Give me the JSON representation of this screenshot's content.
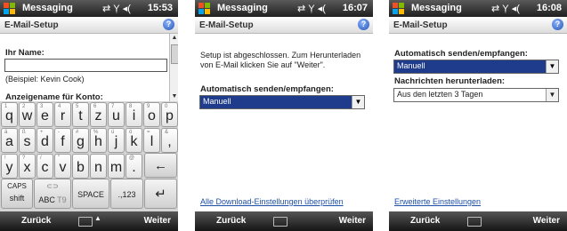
{
  "screens": [
    {
      "status": {
        "app": "Messaging",
        "time": "15:53"
      },
      "header": "E-Mail-Setup",
      "name_label": "Ihr Name:",
      "name_example": "(Beispiel: Kevin Cook)",
      "display_name_label": "Anzeigename für Konto:",
      "keyboard": {
        "row1": [
          {
            "m": "q",
            "s": "1"
          },
          {
            "m": "w",
            "s": "2"
          },
          {
            "m": "e",
            "s": "3"
          },
          {
            "m": "r",
            "s": "4"
          },
          {
            "m": "t",
            "s": "5"
          },
          {
            "m": "z",
            "s": "6"
          },
          {
            "m": "u",
            "s": "7"
          },
          {
            "m": "i",
            "s": "8"
          },
          {
            "m": "o",
            "s": "9"
          },
          {
            "m": "p",
            "s": "0"
          }
        ],
        "row2": [
          {
            "m": "a",
            "s": "ä"
          },
          {
            "m": "s",
            "s": "ß"
          },
          {
            "m": "d",
            "s": "+"
          },
          {
            "m": "f",
            "s": "-"
          },
          {
            "m": "g",
            "s": "#"
          },
          {
            "m": "h",
            "s": "%"
          },
          {
            "m": "j",
            "s": "ü"
          },
          {
            "m": "k",
            "s": "ö"
          },
          {
            "m": "l",
            "s": "="
          },
          {
            "m": ",",
            "s": "&"
          }
        ],
        "row3": [
          {
            "m": "y",
            "s": "!"
          },
          {
            "m": "x",
            "s": "?"
          },
          {
            "m": "c",
            "s": "/"
          },
          {
            "m": "v",
            "s": "\""
          },
          {
            "m": "b",
            "s": ""
          },
          {
            "m": "n",
            "s": ""
          },
          {
            "m": "m",
            "s": ""
          },
          {
            "m": ".",
            "s": "@"
          }
        ],
        "caps_label": "CAPS",
        "shift_label": "shift",
        "abc_label": "ABC",
        "t9_label": "T9",
        "space_label": "SPACE",
        "num_label": ".,123",
        "backspace_icon": "backspace-arrow-icon",
        "enter_icon": "enter-return-icon"
      },
      "softkeys": {
        "left": "Zurück",
        "right": "Weiter"
      }
    },
    {
      "status": {
        "app": "Messaging",
        "time": "16:07"
      },
      "header": "E-Mail-Setup",
      "intro_text_line1": "Setup ist abgeschlossen.  Zum Herunterladen",
      "intro_text_line2": "von E-Mail klicken Sie auf \"Weiter\".",
      "send_receive_label": "Automatisch senden/empfangen:",
      "send_receive_value": "Manuell",
      "link_text": "Alle Download-Einstellungen überprüfen",
      "softkeys": {
        "left": "Zurück",
        "right": "Weiter"
      }
    },
    {
      "status": {
        "app": "Messaging",
        "time": "16:08"
      },
      "header": "E-Mail-Setup",
      "send_receive_label": "Automatisch senden/empfangen:",
      "send_receive_value": "Manuell",
      "download_label": "Nachrichten herunterladen:",
      "download_value": "Aus den letzten 3 Tagen",
      "link_text": "Erweiterte Einstellungen",
      "softkeys": {
        "left": "Zurück",
        "right": "Weiter"
      }
    }
  ],
  "colors": {
    "selection": "#1e3b8c",
    "link": "#1d4fa8"
  }
}
